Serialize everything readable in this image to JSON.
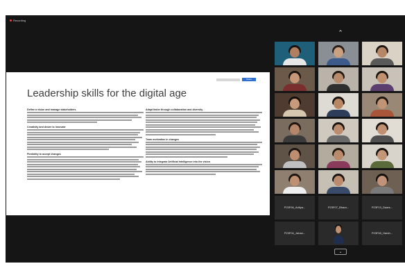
{
  "recording": {
    "label": "Recording"
  },
  "slide": {
    "title": "Leadership skills for the digital age",
    "top_button": "Share",
    "left_sections": [
      {
        "heading": "Define a vision and manage stakeholders",
        "lines": [
          1,
          0.95,
          0.98,
          0.9,
          0.6
        ]
      },
      {
        "heading": "Creativity and desire to innovate",
        "lines": [
          1,
          0.97,
          0.95,
          0.99,
          0.93,
          0.96,
          0.9,
          0.94,
          0.7
        ]
      },
      {
        "heading": "Flexibility to accept changes",
        "lines": [
          1,
          0.96,
          0.98,
          0.95,
          0.97,
          0.94,
          0.99,
          0.92,
          0.96,
          0.8
        ]
      }
    ],
    "right_sections": [
      {
        "heading": "Adapt faster through collaboration and diversity",
        "lines": [
          1,
          0.97,
          0.95,
          0.98,
          0.96,
          0.94,
          0.99,
          0.93,
          0.97,
          0.6
        ]
      },
      {
        "heading": "Team motivation in changes",
        "lines": [
          1,
          0.96,
          0.98,
          0.95,
          0.97,
          0.93,
          0.7
        ]
      },
      {
        "heading": "Ability to integrate Artificial Intelligence into the vision",
        "lines": [
          1,
          0.97,
          0.95,
          0.98,
          0.6
        ]
      }
    ]
  },
  "gallery": {
    "up_label": "⌃",
    "more_label": "⌄",
    "video_tiles": [
      {
        "bg": "#1f5f7a",
        "skin": "#b07f5f",
        "hair": "#1a1210",
        "shirt": "#e8e8e8"
      },
      {
        "bg": "#8a8f95",
        "skin": "#c9a080",
        "hair": "#2a1e18",
        "shirt": "#3c5a8a"
      },
      {
        "bg": "#d9d2c5",
        "skin": "#b58768",
        "hair": "#1e1612",
        "shirt": "#5a5a5a"
      },
      {
        "bg": "#6b5a4a",
        "skin": "#c7977a",
        "hair": "#1b1310",
        "shirt": "#7a2e2e"
      },
      {
        "bg": "#b9b3aa",
        "skin": "#b88a6c",
        "hair": "#221812",
        "shirt": "#2f2f2f"
      },
      {
        "bg": "#c8c2b8",
        "skin": "#bf9170",
        "hair": "#1a120e",
        "shirt": "#5c3f6e"
      },
      {
        "bg": "#4e3c30",
        "skin": "#c89a7c",
        "hair": "#140e0b",
        "shirt": "#d6c7b0"
      },
      {
        "bg": "#dedad4",
        "skin": "#b78766",
        "hair": "#16100c",
        "shirt": "#2d3d5a"
      },
      {
        "bg": "#9a8877",
        "skin": "#c29476",
        "hair": "#1c140f",
        "shirt": "#a8553a"
      },
      {
        "bg": "#7a6c5e",
        "skin": "#b6866a",
        "hair": "#1f1611",
        "shirt": "#3a3a3a"
      },
      {
        "bg": "#cfc9bf",
        "skin": "#bb8c6e",
        "hair": "#1a1310",
        "shirt": "#6a6a6a"
      },
      {
        "bg": "#e2ddd4",
        "skin": "#c09072",
        "hair": "#19110d",
        "shirt": "#4f4f4f"
      },
      {
        "bg": "#5f5347",
        "skin": "#bd8e70",
        "hair": "#1b130f",
        "shirt": "#c0c0c0"
      },
      {
        "bg": "#b4ab9f",
        "skin": "#b98a6b",
        "hair": "#20170f",
        "shirt": "#8a3a5a"
      },
      {
        "bg": "#d8d4cc",
        "skin": "#c39677",
        "hair": "#17100c",
        "shirt": "#5a6a3a"
      },
      {
        "bg": "#8e7f70",
        "skin": "#be8f71",
        "hair": "#1e1510",
        "shirt": "#eeeeee"
      },
      {
        "bg": "#c6bfb4",
        "skin": "#ba8b6d",
        "hair": "#1a1210",
        "shirt": "#3a4a6a"
      },
      {
        "bg": "#6e6052",
        "skin": "#c1937a",
        "hair": "#150f0b",
        "shirt": "#7a7a7a"
      }
    ],
    "name_tiles": [
      {
        "name": "P23F06_Aditya..."
      },
      {
        "name": "P23F07_Bhara..."
      },
      {
        "name": "P23F13_Daars..."
      },
      {
        "name": "P23F04_Jahan..."
      },
      {
        "name": "P23F45_Harsh..."
      }
    ],
    "photo_tile": {
      "bg": "#2a2a2a",
      "skin": "#c09070",
      "hair": "#111111",
      "shirt": "#1f2f4f"
    }
  }
}
